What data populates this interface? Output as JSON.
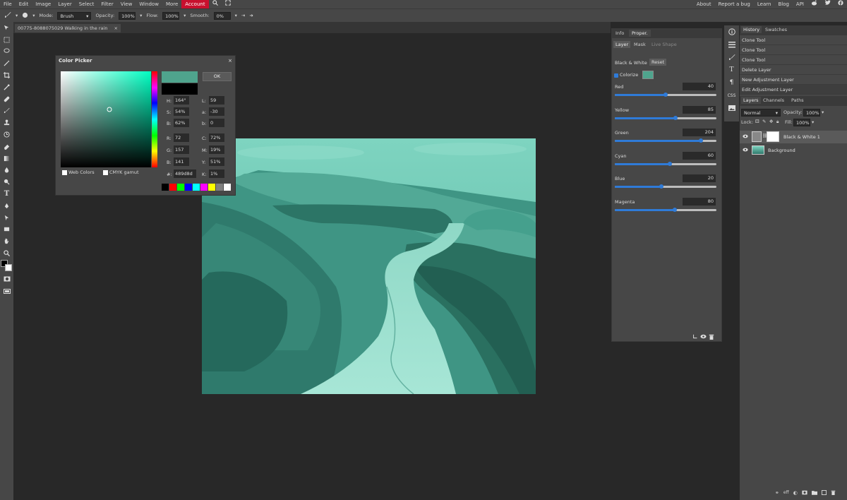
{
  "menu": {
    "items": [
      "File",
      "Edit",
      "Image",
      "Layer",
      "Select",
      "Filter",
      "View",
      "Window",
      "More",
      "Account"
    ],
    "right_items": [
      "About",
      "Report a bug",
      "Learn",
      "Blog",
      "API"
    ]
  },
  "options_bar": {
    "mode_label": "Mode:",
    "mode_value": "Brush",
    "opacity_label": "Opacity:",
    "opacity_value": "100%",
    "flow_label": "Flow:",
    "flow_value": "100%",
    "smooth_label": "Smooth:",
    "smooth_value": "0%"
  },
  "document_tab": {
    "title": "00775-8088075029 Walking in the rain",
    "close": "×"
  },
  "color_picker": {
    "title": "Color Picker",
    "ok_label": "OK",
    "new_color": "#4fa48d",
    "old_color": "#000000",
    "hsb": [
      {
        "label": "H:",
        "value": "164°"
      },
      {
        "label": "S:",
        "value": "54%"
      },
      {
        "label": "B:",
        "value": "62%"
      }
    ],
    "lab": [
      {
        "label": "L:",
        "value": "59"
      },
      {
        "label": "a:",
        "value": "-30"
      },
      {
        "label": "b:",
        "value": "0"
      }
    ],
    "rgb": [
      {
        "label": "R:",
        "value": "72"
      },
      {
        "label": "G:",
        "value": "157"
      },
      {
        "label": "B:",
        "value": "141"
      }
    ],
    "cmyk": [
      {
        "label": "C:",
        "value": "72%"
      },
      {
        "label": "M:",
        "value": "19%"
      },
      {
        "label": "Y:",
        "value": "51%"
      },
      {
        "label": "K:",
        "value": "1%"
      }
    ],
    "hex_label": "#:",
    "hex_value": "489d8d",
    "web_colors_label": "Web Colors",
    "cmyk_gamut_label": "CMYK gamut",
    "swatches": [
      "#000000",
      "#ff0000",
      "#00ff00",
      "#0000ff",
      "#00ffff",
      "#ff00ff",
      "#ffff00",
      "#808080",
      "#ffffff"
    ]
  },
  "properties_panel": {
    "tabs": [
      "Info",
      "Proper."
    ],
    "subtabs": [
      "Layer",
      "Mask",
      "Live Shape"
    ],
    "adjustment_name": "Black & White",
    "reset_label": "Reset",
    "colorize_label": "Colorize",
    "colorize_checked": true,
    "tint_color": "#4fa48d",
    "channels": [
      {
        "name": "Red",
        "value": "40",
        "fraction": 0.5
      },
      {
        "name": "Yellow",
        "value": "85",
        "fraction": 0.6
      },
      {
        "name": "Green",
        "value": "204",
        "fraction": 0.85
      },
      {
        "name": "Cyan",
        "value": "60",
        "fraction": 0.54
      },
      {
        "name": "Blue",
        "value": "20",
        "fraction": 0.46
      },
      {
        "name": "Magenta",
        "value": "80",
        "fraction": 0.59
      }
    ]
  },
  "history_panel": {
    "tabs": [
      "History",
      "Swatches"
    ],
    "items": [
      "Clone Tool",
      "Clone Tool",
      "Clone Tool",
      "Delete Layer",
      "New Adjustment Layer",
      "Edit Adjustment Layer"
    ]
  },
  "layers_panel": {
    "tabs": [
      "Layers",
      "Channels",
      "Paths"
    ],
    "blend_mode": "Normal",
    "opacity_label": "Opacity:",
    "opacity_value": "100%",
    "lock_label": "Lock:",
    "fill_label": "Fill:",
    "fill_value": "100%",
    "layers": [
      {
        "name": "Black & White 1",
        "selected": true
      },
      {
        "name": "Background",
        "selected": false
      }
    ]
  }
}
